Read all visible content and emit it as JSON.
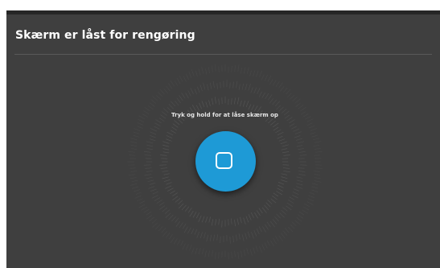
{
  "header": {
    "title": "Skærm er låst for rengøring"
  },
  "unlock": {
    "instruction": "Tryk og hold for at låse skærm op",
    "button_icon": "square-icon"
  },
  "colors": {
    "background": "#3f3f3f",
    "accent": "#1e9ad6",
    "text": "#ffffff"
  }
}
